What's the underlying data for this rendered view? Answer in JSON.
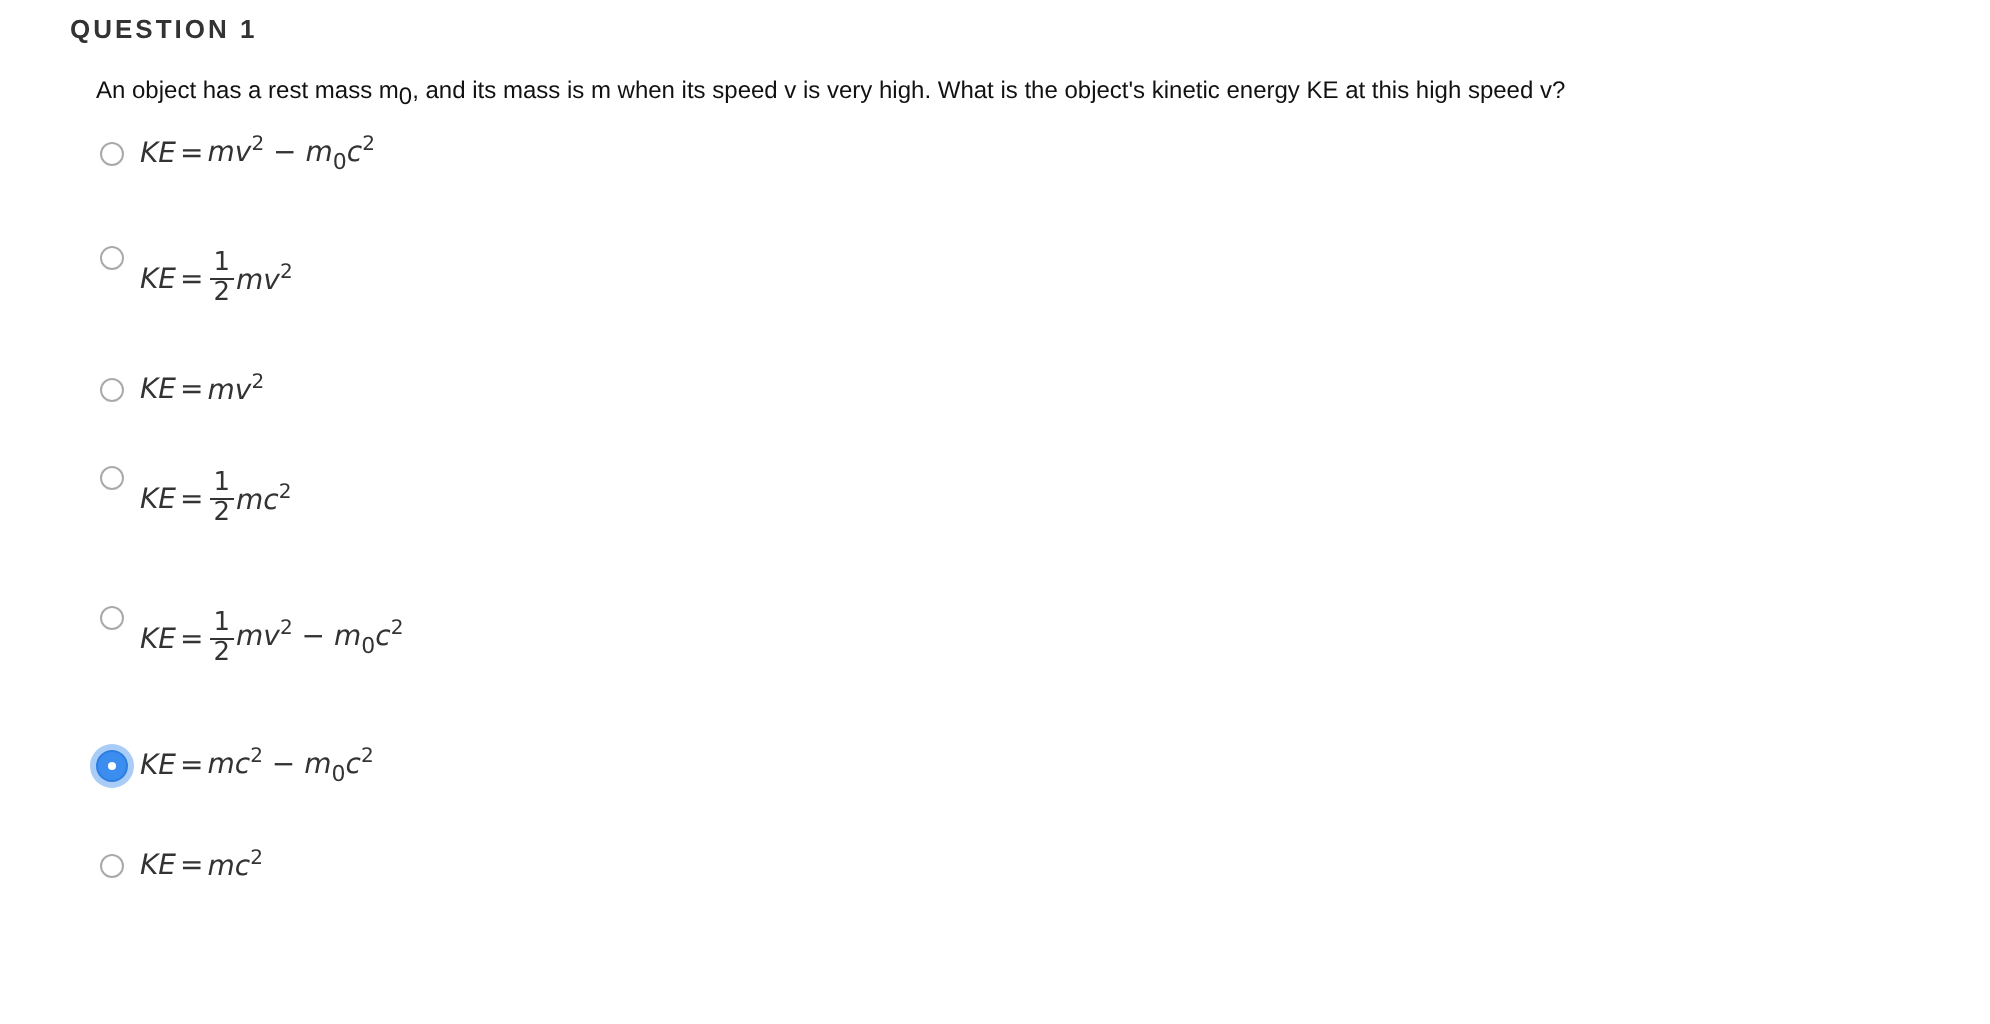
{
  "question": {
    "heading": "QUESTION 1",
    "text": "An object has a rest mass m$_{0}$, and its mass is m when its speed v  is very high. What is the object's kinetic energy KE at this high speed v?"
  },
  "options": [
    {
      "kind": "plain",
      "selected": false,
      "lhs": "KE",
      "eq": "=",
      "rest": "mv$^{2}$ − m$_{0}$c$^{2}$"
    },
    {
      "kind": "fraction",
      "selected": false,
      "lhs": "KE",
      "eq": "=",
      "numerator": "1",
      "denominator": "2",
      "rest": "mv$^{2}$"
    },
    {
      "kind": "plain",
      "selected": false,
      "lhs": "KE",
      "eq": "=",
      "rest": "mv$^{2}$"
    },
    {
      "kind": "fraction",
      "selected": false,
      "lhs": "KE",
      "eq": "=",
      "numerator": "1",
      "denominator": "2",
      "rest": "mc$^{2}$"
    },
    {
      "kind": "fraction",
      "selected": false,
      "lhs": "KE",
      "eq": "=",
      "numerator": "1",
      "denominator": "2",
      "rest": "mv$^{2}$ − m$_{0}$c$^{2}$"
    },
    {
      "kind": "plain",
      "selected": true,
      "lhs": "KE",
      "eq": "=",
      "rest": "mc$^{2}$ − m$_{0}$c$^{2}$"
    },
    {
      "kind": "plain",
      "selected": false,
      "lhs": "KE",
      "eq": "=",
      "rest": "mc$^{2}$"
    }
  ]
}
